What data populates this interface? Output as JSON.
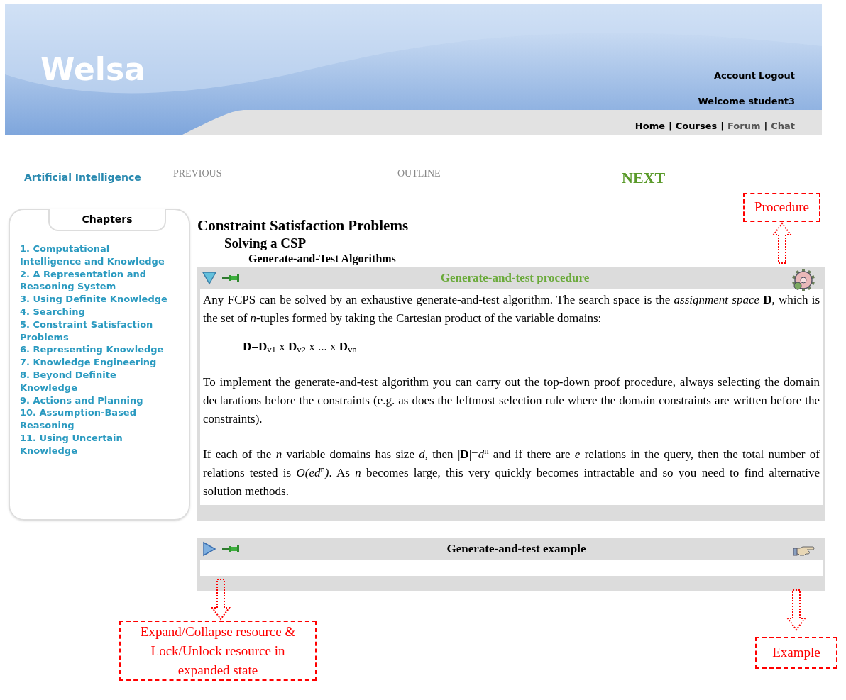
{
  "header": {
    "logo": "Welsa",
    "account_links": [
      {
        "label": "Account"
      },
      {
        "label": "Logout"
      }
    ],
    "welcome": "Welcome student3",
    "nav": [
      {
        "label": "Home",
        "selected": true
      },
      {
        "label": "Courses",
        "selected": true
      },
      {
        "label": "Forum",
        "selected": false
      },
      {
        "label": "Chat",
        "selected": false
      }
    ],
    "separator": "|"
  },
  "course": "Artificial Intelligence",
  "lesson_nav": [
    {
      "label": "PREVIOUS",
      "disabled": true
    },
    {
      "label": "OUTLINE",
      "disabled": true
    },
    {
      "label": "NEXT",
      "disabled": false
    }
  ],
  "sidebar": {
    "title": "Chapters",
    "items": [
      "1. Computational Intelligence and Knowledge",
      "2. A Representation and Reasoning System",
      "3. Using Definite Knowledge",
      "4. Searching",
      "5. Constraint Satisfaction Problems",
      "6. Representing Knowledge",
      "7. Knowledge Engineering",
      "8. Beyond Definite Knowledge",
      "9. Actions and Planning",
      "10. Assumption-Based Reasoning",
      "11. Using Uncertain Knowledge"
    ]
  },
  "breadcrumb": [
    "Constraint Satisfaction Problems",
    "Solving a CSP",
    "Generate-and-Test Algorithms"
  ],
  "resources": [
    {
      "kind": "procedure",
      "title": "Generate-and-test procedure",
      "expanded": true,
      "paragraphs": [
        {
          "kind": "text",
          "text": "Any FCPS can be solved by an exhaustive generate-and-test algorithm. The search space is the *assignment space* **D**, which is the set of *n*-tuples formed by taking the Cartesian product of the variable domains:"
        },
        {
          "kind": "formula",
          "text": "**D**=**D**$_{v1}$ x **D**$_{v2}$ x ... x **D**$_{vn}$"
        },
        {
          "kind": "text",
          "text": "To implement the generate-and-test algorithm you can carry out the top-down proof procedure, always selecting the domain declarations before the constraints (e.g. as does the leftmost selection rule where the domain constraints are written before the constraints)."
        },
        {
          "kind": "text",
          "text": "If each of the *n* variable domains has size *d*, then |**D**|=*d*$^{n}$ and if there are *e* relations in the query, then the total number of relations tested is *O(ed*$^{n}$*)*. As *n* becomes large, this very quickly becomes intractable and so you need to find alternative solution methods."
        }
      ]
    },
    {
      "kind": "example",
      "title": "Generate-and-test example",
      "expanded": false
    }
  ],
  "annotations": [
    {
      "kind": "procedure",
      "text": "Procedure"
    },
    {
      "kind": "toggle",
      "text": "Expand/Collapse resource & Lock/Unlock resource in expanded state"
    },
    {
      "kind": "example",
      "text": "Example"
    }
  ]
}
